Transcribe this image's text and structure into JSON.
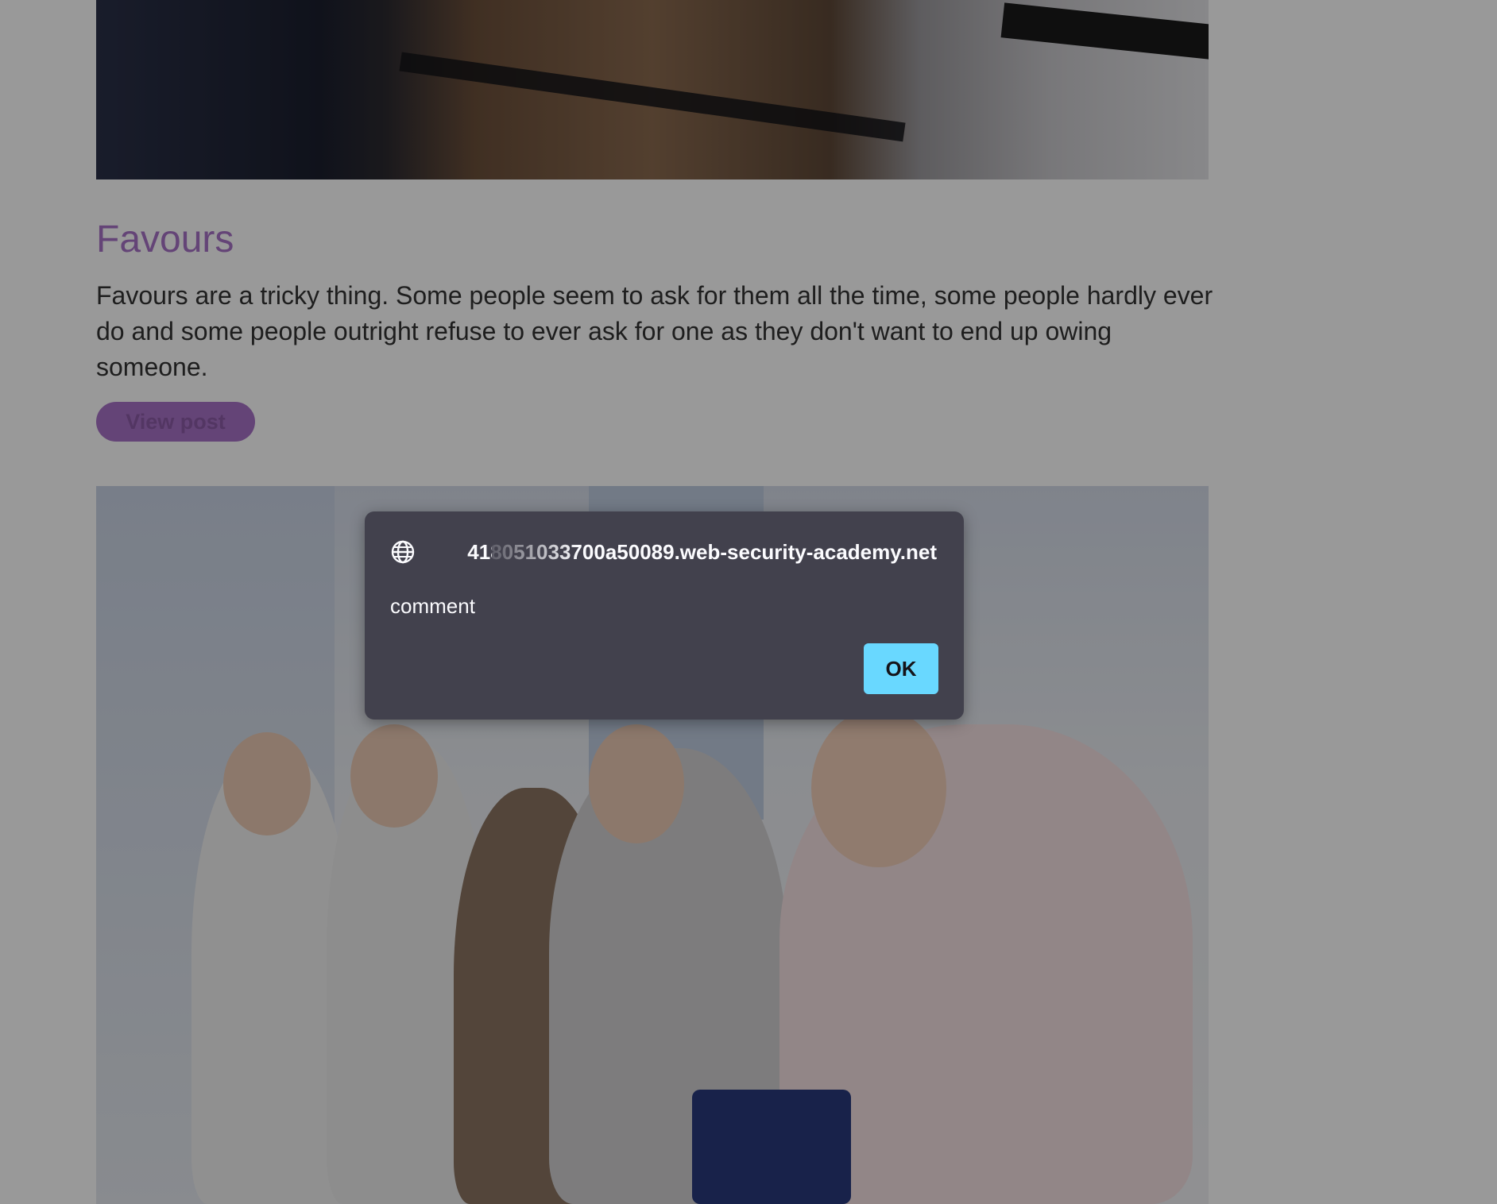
{
  "post": {
    "title": "Favours",
    "summary": "Favours are a tricky thing. Some people seem to ask for them all the time, some people hardly ever do and some people outright refuse to ever ask for one as they don't want to end up owing someone.",
    "view_post_label": "View post"
  },
  "dialog": {
    "origin": "418051033700a50089.web-security-academy.net",
    "message": "comment",
    "ok_label": "OK"
  },
  "icons": {
    "origin_icon": "globe-icon"
  },
  "colors": {
    "accent": "#a772c6",
    "dialog_background": "#42414d",
    "dialog_text": "#fbfbfe",
    "ok_button": "#69d8ff",
    "overlay": "rgba(0,0,0,0.40)"
  }
}
